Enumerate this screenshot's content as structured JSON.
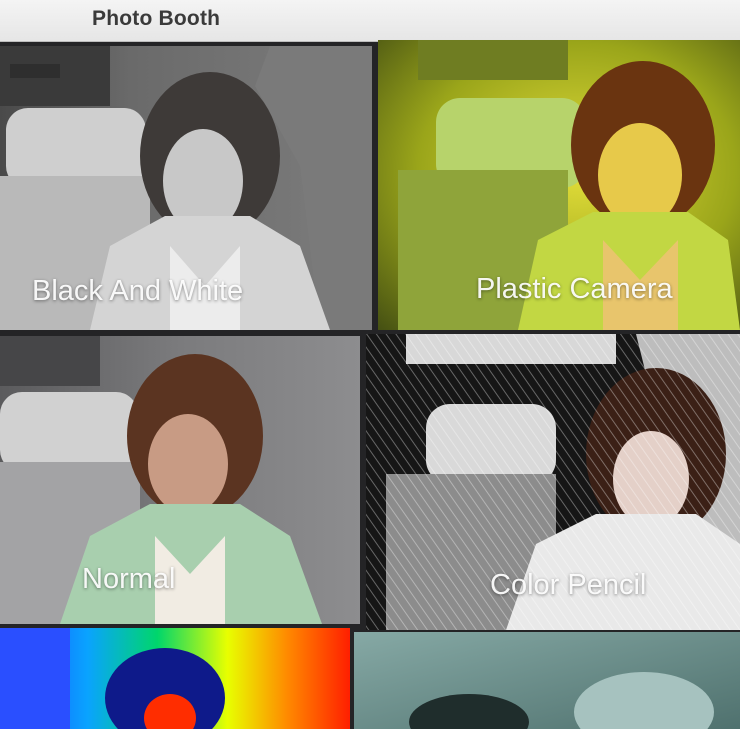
{
  "app": {
    "title": "Photo Booth"
  },
  "effects": [
    {
      "label": "Black And White",
      "tint": "#8e8e8e"
    },
    {
      "label": "Plastic Camera",
      "tint": "#b6c800"
    },
    {
      "label": "Normal",
      "tint": "#9fc1a3"
    },
    {
      "label": "Color Pencil",
      "tint": "#d9d9d9"
    },
    {
      "label": "",
      "tint": "#ff5a00"
    },
    {
      "label": "",
      "tint": "#5f8a86"
    }
  ]
}
